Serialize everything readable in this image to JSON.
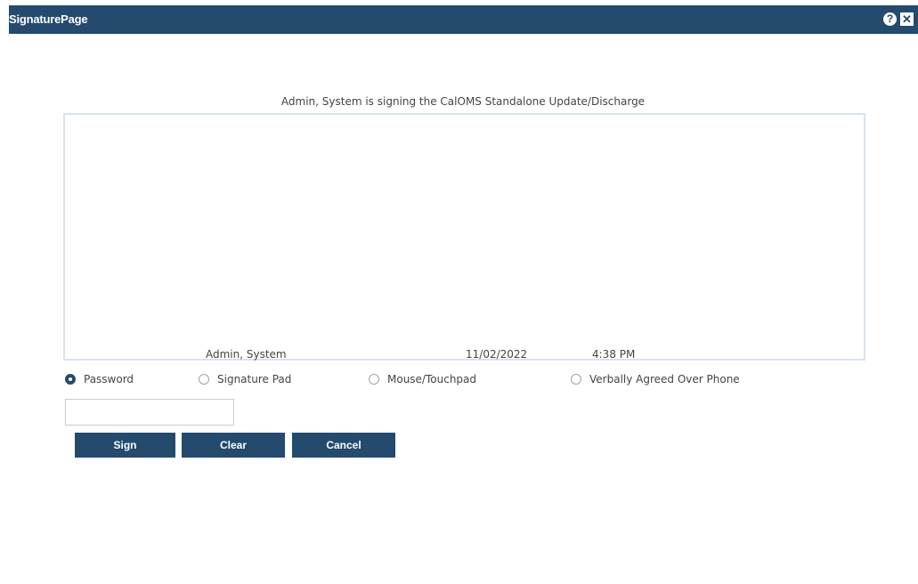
{
  "window": {
    "title": "SignaturePage",
    "help_icon": "?",
    "close_icon": "✕"
  },
  "signature": {
    "heading": "Admin, System is signing the CalOMS Standalone Update/Discharge",
    "signer_name": "Admin, System",
    "date": "11/02/2022",
    "time": "4:38 PM"
  },
  "methods": [
    {
      "label": "Password",
      "selected": true
    },
    {
      "label": "Signature Pad",
      "selected": false
    },
    {
      "label": "Mouse/Touchpad",
      "selected": false
    },
    {
      "label": "Verbally Agreed Over Phone",
      "selected": false
    }
  ],
  "password": {
    "value": "",
    "placeholder": ""
  },
  "buttons": {
    "sign": "Sign",
    "clear": "Clear",
    "cancel": "Cancel"
  },
  "colors": {
    "titlebar": "#244a6e",
    "button": "#244a6e",
    "signature_border": "#d8e2ec"
  }
}
